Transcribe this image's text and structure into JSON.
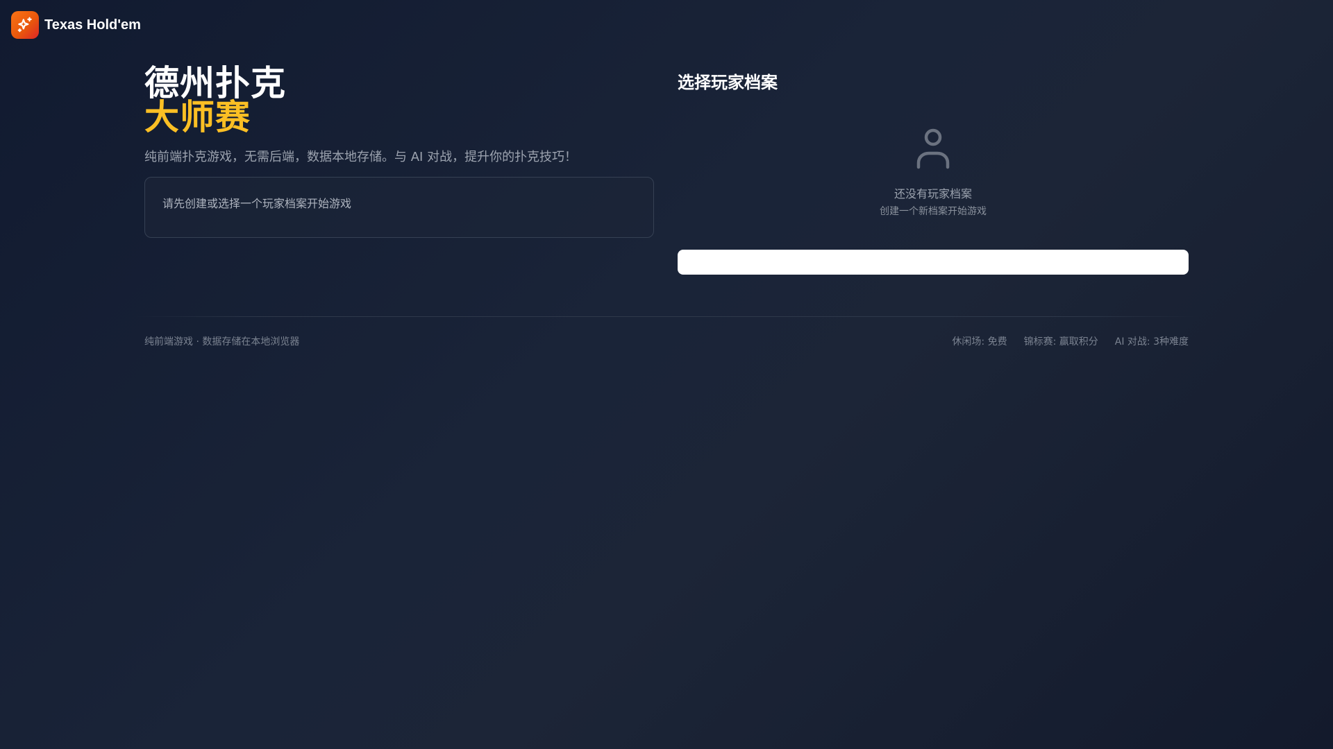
{
  "brand": {
    "name": "Texas Hold'em",
    "logo_icon": "sparkles-icon",
    "accent_color": "#f97316"
  },
  "hero": {
    "title_line1": "德州扑克",
    "title_line2": "大师赛",
    "title_accent_color": "#fbbf24",
    "subtitle": "纯前端扑克游戏，无需后端，数据本地存储。与 AI 对战，提升你的扑克技巧！",
    "notice": "请先创建或选择一个玩家档案开始游戏"
  },
  "profile_panel": {
    "title": "选择玩家档案",
    "empty_icon": "user-icon",
    "empty_title": "还没有玩家档案",
    "empty_subtitle": "创建一个新档案开始游戏"
  },
  "footer": {
    "left": "纯前端游戏 · 数据存储在本地浏览器",
    "items": [
      "休闲场: 免费",
      "锦标赛: 赢取积分",
      "AI 对战: 3种难度"
    ]
  }
}
